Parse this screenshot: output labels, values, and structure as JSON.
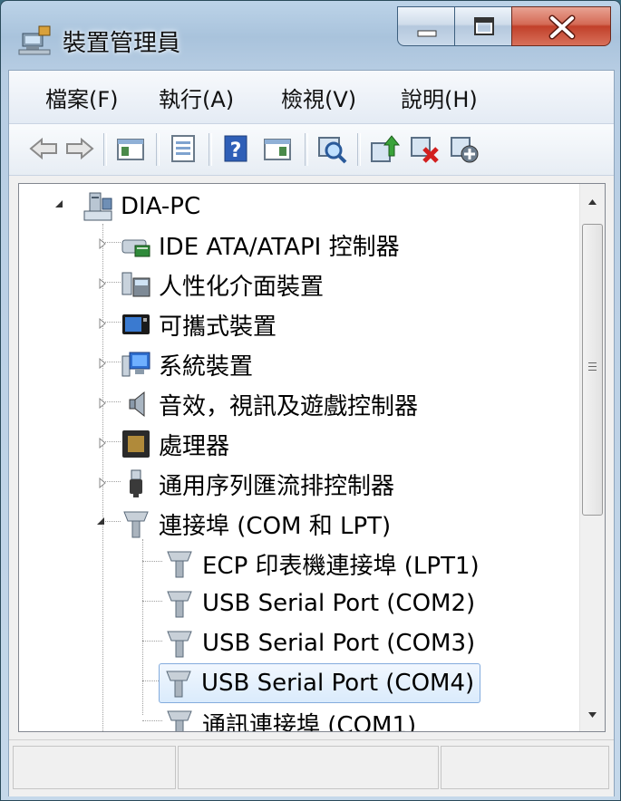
{
  "window": {
    "title": "裝置管理員"
  },
  "menu": [
    {
      "label": "檔案(F)"
    },
    {
      "label": "執行(A)"
    },
    {
      "label": "檢視(V)"
    },
    {
      "label": "說明(H)"
    }
  ],
  "tree": {
    "root": "DIA-PC",
    "categories": [
      {
        "label": "IDE ATA/ATAPI 控制器",
        "icon": "ide-controller-icon"
      },
      {
        "label": "人性化介面裝置",
        "icon": "hid-icon"
      },
      {
        "label": "可攜式裝置",
        "icon": "portable-device-icon"
      },
      {
        "label": "系統裝置",
        "icon": "system-device-icon"
      },
      {
        "label": "音效，視訊及遊戲控制器",
        "icon": "speaker-icon"
      },
      {
        "label": "處理器",
        "icon": "processor-icon"
      },
      {
        "label": "通用序列匯流排控制器",
        "icon": "usb-icon"
      },
      {
        "label": "連接埠 (COM 和 LPT)",
        "icon": "port-icon"
      }
    ],
    "ports": [
      {
        "label": "ECP 印表機連接埠 (LPT1)"
      },
      {
        "label": "USB Serial Port (COM2)"
      },
      {
        "label": "USB Serial Port (COM3)"
      },
      {
        "label": "USB Serial Port (COM4)"
      },
      {
        "label": "通訊連接埠 (COM1)"
      }
    ]
  },
  "colors": {
    "selection_border": "#84acdd",
    "close_button": "#c1402a"
  }
}
